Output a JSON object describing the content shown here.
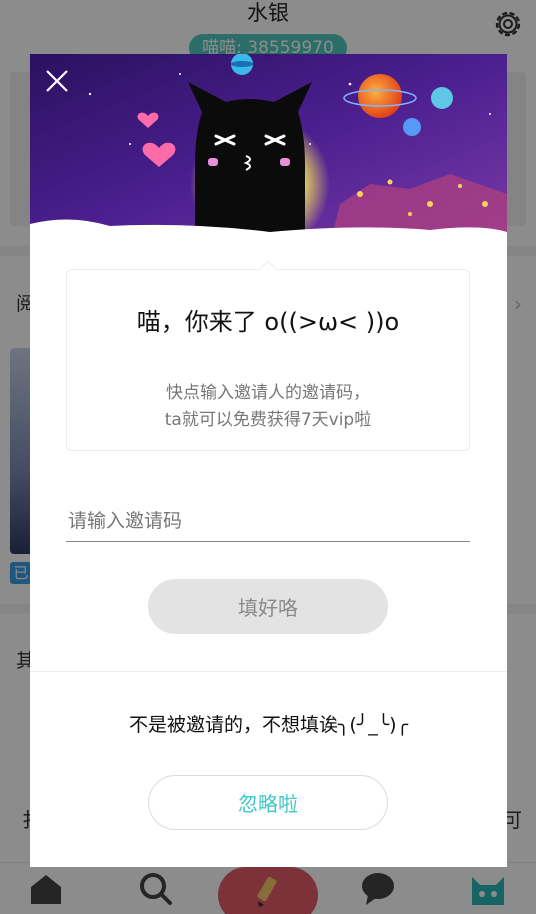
{
  "background": {
    "title": "水银",
    "badge": "喵喵: 38559970",
    "section_left_char": "阅",
    "book_tag": "已",
    "lower_left_char": "其",
    "edge_left_char": "扌",
    "edge_right_char": "可"
  },
  "dialog": {
    "headline": "喵，你来了 o((>ω< ))o",
    "description_line1": "快点输入邀请人的邀请码，",
    "description_line2": "ta就可以免费获得7天vip啦",
    "input_placeholder": "请输入邀请码",
    "input_value": "",
    "submit_label": "填好咯",
    "skip_text": "不是被邀请的，不想填诶╮(╯_╰)╭",
    "ignore_label": "忽略啦"
  },
  "colors": {
    "accent": "#3fc7c9",
    "badge": "#4fc8bd",
    "submit_disabled_bg": "#e3e3e3",
    "write_tab": "#e35c6a"
  },
  "icons": {
    "close": "close-icon",
    "settings": "gear-icon",
    "home": "home-icon",
    "search": "search-icon",
    "write": "pencil-icon",
    "messages": "chat-bubble-icon",
    "profile": "cat-icon"
  }
}
